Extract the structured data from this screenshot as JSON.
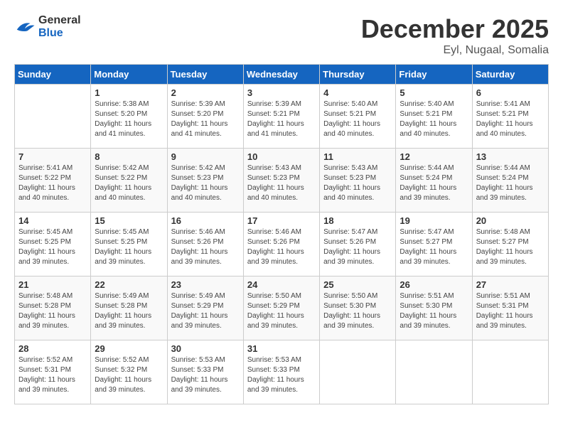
{
  "header": {
    "logo_general": "General",
    "logo_blue": "Blue",
    "month_title": "December 2025",
    "location": "Eyl, Nugaal, Somalia"
  },
  "calendar": {
    "days_of_week": [
      "Sunday",
      "Monday",
      "Tuesday",
      "Wednesday",
      "Thursday",
      "Friday",
      "Saturday"
    ],
    "weeks": [
      [
        {
          "day": "",
          "sunrise": "",
          "sunset": "",
          "daylight": ""
        },
        {
          "day": "1",
          "sunrise": "Sunrise: 5:38 AM",
          "sunset": "Sunset: 5:20 PM",
          "daylight": "Daylight: 11 hours and 41 minutes."
        },
        {
          "day": "2",
          "sunrise": "Sunrise: 5:39 AM",
          "sunset": "Sunset: 5:20 PM",
          "daylight": "Daylight: 11 hours and 41 minutes."
        },
        {
          "day": "3",
          "sunrise": "Sunrise: 5:39 AM",
          "sunset": "Sunset: 5:21 PM",
          "daylight": "Daylight: 11 hours and 41 minutes."
        },
        {
          "day": "4",
          "sunrise": "Sunrise: 5:40 AM",
          "sunset": "Sunset: 5:21 PM",
          "daylight": "Daylight: 11 hours and 40 minutes."
        },
        {
          "day": "5",
          "sunrise": "Sunrise: 5:40 AM",
          "sunset": "Sunset: 5:21 PM",
          "daylight": "Daylight: 11 hours and 40 minutes."
        },
        {
          "day": "6",
          "sunrise": "Sunrise: 5:41 AM",
          "sunset": "Sunset: 5:21 PM",
          "daylight": "Daylight: 11 hours and 40 minutes."
        }
      ],
      [
        {
          "day": "7",
          "sunrise": "Sunrise: 5:41 AM",
          "sunset": "Sunset: 5:22 PM",
          "daylight": "Daylight: 11 hours and 40 minutes."
        },
        {
          "day": "8",
          "sunrise": "Sunrise: 5:42 AM",
          "sunset": "Sunset: 5:22 PM",
          "daylight": "Daylight: 11 hours and 40 minutes."
        },
        {
          "day": "9",
          "sunrise": "Sunrise: 5:42 AM",
          "sunset": "Sunset: 5:23 PM",
          "daylight": "Daylight: 11 hours and 40 minutes."
        },
        {
          "day": "10",
          "sunrise": "Sunrise: 5:43 AM",
          "sunset": "Sunset: 5:23 PM",
          "daylight": "Daylight: 11 hours and 40 minutes."
        },
        {
          "day": "11",
          "sunrise": "Sunrise: 5:43 AM",
          "sunset": "Sunset: 5:23 PM",
          "daylight": "Daylight: 11 hours and 40 minutes."
        },
        {
          "day": "12",
          "sunrise": "Sunrise: 5:44 AM",
          "sunset": "Sunset: 5:24 PM",
          "daylight": "Daylight: 11 hours and 39 minutes."
        },
        {
          "day": "13",
          "sunrise": "Sunrise: 5:44 AM",
          "sunset": "Sunset: 5:24 PM",
          "daylight": "Daylight: 11 hours and 39 minutes."
        }
      ],
      [
        {
          "day": "14",
          "sunrise": "Sunrise: 5:45 AM",
          "sunset": "Sunset: 5:25 PM",
          "daylight": "Daylight: 11 hours and 39 minutes."
        },
        {
          "day": "15",
          "sunrise": "Sunrise: 5:45 AM",
          "sunset": "Sunset: 5:25 PM",
          "daylight": "Daylight: 11 hours and 39 minutes."
        },
        {
          "day": "16",
          "sunrise": "Sunrise: 5:46 AM",
          "sunset": "Sunset: 5:26 PM",
          "daylight": "Daylight: 11 hours and 39 minutes."
        },
        {
          "day": "17",
          "sunrise": "Sunrise: 5:46 AM",
          "sunset": "Sunset: 5:26 PM",
          "daylight": "Daylight: 11 hours and 39 minutes."
        },
        {
          "day": "18",
          "sunrise": "Sunrise: 5:47 AM",
          "sunset": "Sunset: 5:26 PM",
          "daylight": "Daylight: 11 hours and 39 minutes."
        },
        {
          "day": "19",
          "sunrise": "Sunrise: 5:47 AM",
          "sunset": "Sunset: 5:27 PM",
          "daylight": "Daylight: 11 hours and 39 minutes."
        },
        {
          "day": "20",
          "sunrise": "Sunrise: 5:48 AM",
          "sunset": "Sunset: 5:27 PM",
          "daylight": "Daylight: 11 hours and 39 minutes."
        }
      ],
      [
        {
          "day": "21",
          "sunrise": "Sunrise: 5:48 AM",
          "sunset": "Sunset: 5:28 PM",
          "daylight": "Daylight: 11 hours and 39 minutes."
        },
        {
          "day": "22",
          "sunrise": "Sunrise: 5:49 AM",
          "sunset": "Sunset: 5:28 PM",
          "daylight": "Daylight: 11 hours and 39 minutes."
        },
        {
          "day": "23",
          "sunrise": "Sunrise: 5:49 AM",
          "sunset": "Sunset: 5:29 PM",
          "daylight": "Daylight: 11 hours and 39 minutes."
        },
        {
          "day": "24",
          "sunrise": "Sunrise: 5:50 AM",
          "sunset": "Sunset: 5:29 PM",
          "daylight": "Daylight: 11 hours and 39 minutes."
        },
        {
          "day": "25",
          "sunrise": "Sunrise: 5:50 AM",
          "sunset": "Sunset: 5:30 PM",
          "daylight": "Daylight: 11 hours and 39 minutes."
        },
        {
          "day": "26",
          "sunrise": "Sunrise: 5:51 AM",
          "sunset": "Sunset: 5:30 PM",
          "daylight": "Daylight: 11 hours and 39 minutes."
        },
        {
          "day": "27",
          "sunrise": "Sunrise: 5:51 AM",
          "sunset": "Sunset: 5:31 PM",
          "daylight": "Daylight: 11 hours and 39 minutes."
        }
      ],
      [
        {
          "day": "28",
          "sunrise": "Sunrise: 5:52 AM",
          "sunset": "Sunset: 5:31 PM",
          "daylight": "Daylight: 11 hours and 39 minutes."
        },
        {
          "day": "29",
          "sunrise": "Sunrise: 5:52 AM",
          "sunset": "Sunset: 5:32 PM",
          "daylight": "Daylight: 11 hours and 39 minutes."
        },
        {
          "day": "30",
          "sunrise": "Sunrise: 5:53 AM",
          "sunset": "Sunset: 5:33 PM",
          "daylight": "Daylight: 11 hours and 39 minutes."
        },
        {
          "day": "31",
          "sunrise": "Sunrise: 5:53 AM",
          "sunset": "Sunset: 5:33 PM",
          "daylight": "Daylight: 11 hours and 39 minutes."
        },
        {
          "day": "",
          "sunrise": "",
          "sunset": "",
          "daylight": ""
        },
        {
          "day": "",
          "sunrise": "",
          "sunset": "",
          "daylight": ""
        },
        {
          "day": "",
          "sunrise": "",
          "sunset": "",
          "daylight": ""
        }
      ]
    ]
  }
}
